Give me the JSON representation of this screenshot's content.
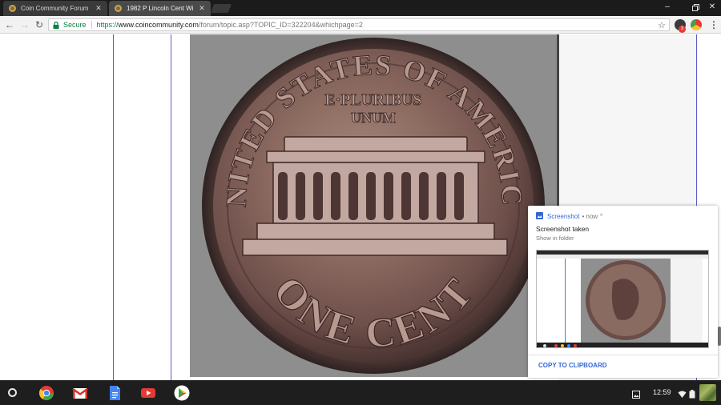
{
  "browser": {
    "tabs": [
      {
        "title": "Coin Community Forum",
        "active": false
      },
      {
        "title": "1982 P Lincoln Cent Wi",
        "active": true
      }
    ],
    "address": {
      "secure_label": "Secure",
      "url_scheme": "https://",
      "url_host": "www.coincommunity.com",
      "url_path": "/forum/topic.asp?TOPIC_ID=322204&whichpage=2"
    },
    "extension_badge_count": "3"
  },
  "content": {
    "coin_text": {
      "top_legend": "UNITED STATES OF AMERICA",
      "motto_line1": "E·PLURIBUS",
      "motto_line2": "UNUM",
      "denomination": "ONE CENT"
    }
  },
  "notification": {
    "app_name": "Screenshot",
    "time": "• now",
    "title": "Screenshot taken",
    "subtitle": "Show in folder",
    "action": "COPY TO CLIPBOARD"
  },
  "shelf": {
    "apps": [
      "chrome-icon",
      "gmail-icon",
      "docs-icon",
      "youtube-icon",
      "play-store-icon"
    ],
    "time": "12:59"
  },
  "colors": {
    "link_blue": "#3367d6",
    "secure_green": "#0b8043",
    "shelf_bg": "#1e1e1e"
  }
}
